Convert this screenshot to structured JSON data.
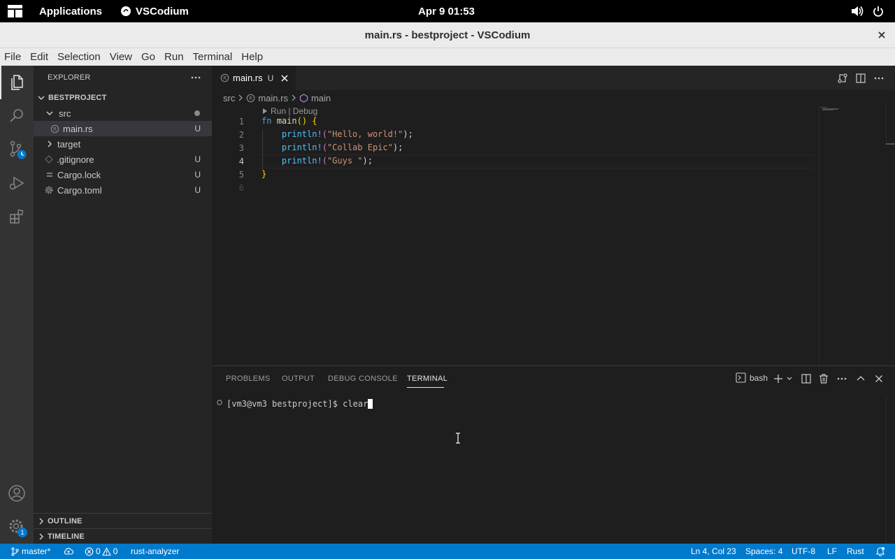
{
  "topbar": {
    "applications": "Applications",
    "app_name": "VSCodium",
    "clock": "Apr 9  01:53"
  },
  "window": {
    "title": "main.rs - bestproject - VSCodium"
  },
  "menu": [
    "File",
    "Edit",
    "Selection",
    "View",
    "Go",
    "Run",
    "Terminal",
    "Help"
  ],
  "sidebar": {
    "header": "EXPLORER",
    "project": "BESTPROJECT",
    "tree": [
      {
        "label": "src",
        "badge": ""
      },
      {
        "label": "main.rs",
        "badge": "U"
      },
      {
        "label": "target",
        "badge": ""
      },
      {
        "label": ".gitignore",
        "badge": "U"
      },
      {
        "label": "Cargo.lock",
        "badge": "U"
      },
      {
        "label": "Cargo.toml",
        "badge": "U"
      }
    ],
    "outline": "OUTLINE",
    "timeline": "TIMELINE"
  },
  "editor": {
    "tab_label": "main.rs",
    "tab_badge": "U",
    "breadcrumb": [
      "src",
      "main.rs",
      "main"
    ],
    "codelens": "Run | Debug",
    "line_numbers": [
      "1",
      "2",
      "3",
      "4",
      "5",
      "6"
    ],
    "code": {
      "l1_kw": "fn",
      "l1_name": "main",
      "l1_parens": "()",
      "l1_brace": "{",
      "l2_macro": "println!",
      "l2_str": "\"Hello, world!\"",
      "l3_macro": "println!",
      "l3_str": "\"Collab Epic\"",
      "l4_macro": "println!",
      "l4_str": "\"Guys \"",
      "open_paren": "(",
      "close_stmt": ");",
      "l5_brace": "}"
    }
  },
  "panel": {
    "tabs": [
      "PROBLEMS",
      "OUTPUT",
      "DEBUG CONSOLE",
      "TERMINAL"
    ],
    "shell": "bash",
    "prompt": "[vm3@vm3 bestproject]$ ",
    "command": "clear"
  },
  "statusbar": {
    "branch": "master*",
    "errors": "0",
    "warnings": "0",
    "lsp": "rust-analyzer",
    "position": "Ln 4, Col 23",
    "spaces": "Spaces: 4",
    "encoding": "UTF-8",
    "eol": "LF",
    "language": "Rust"
  },
  "badges": {
    "settings_count": "1"
  },
  "colors": {
    "accent": "#007acc",
    "activity_bar": "#333333",
    "sidebar": "#252526",
    "editor": "#1e1e1e"
  }
}
